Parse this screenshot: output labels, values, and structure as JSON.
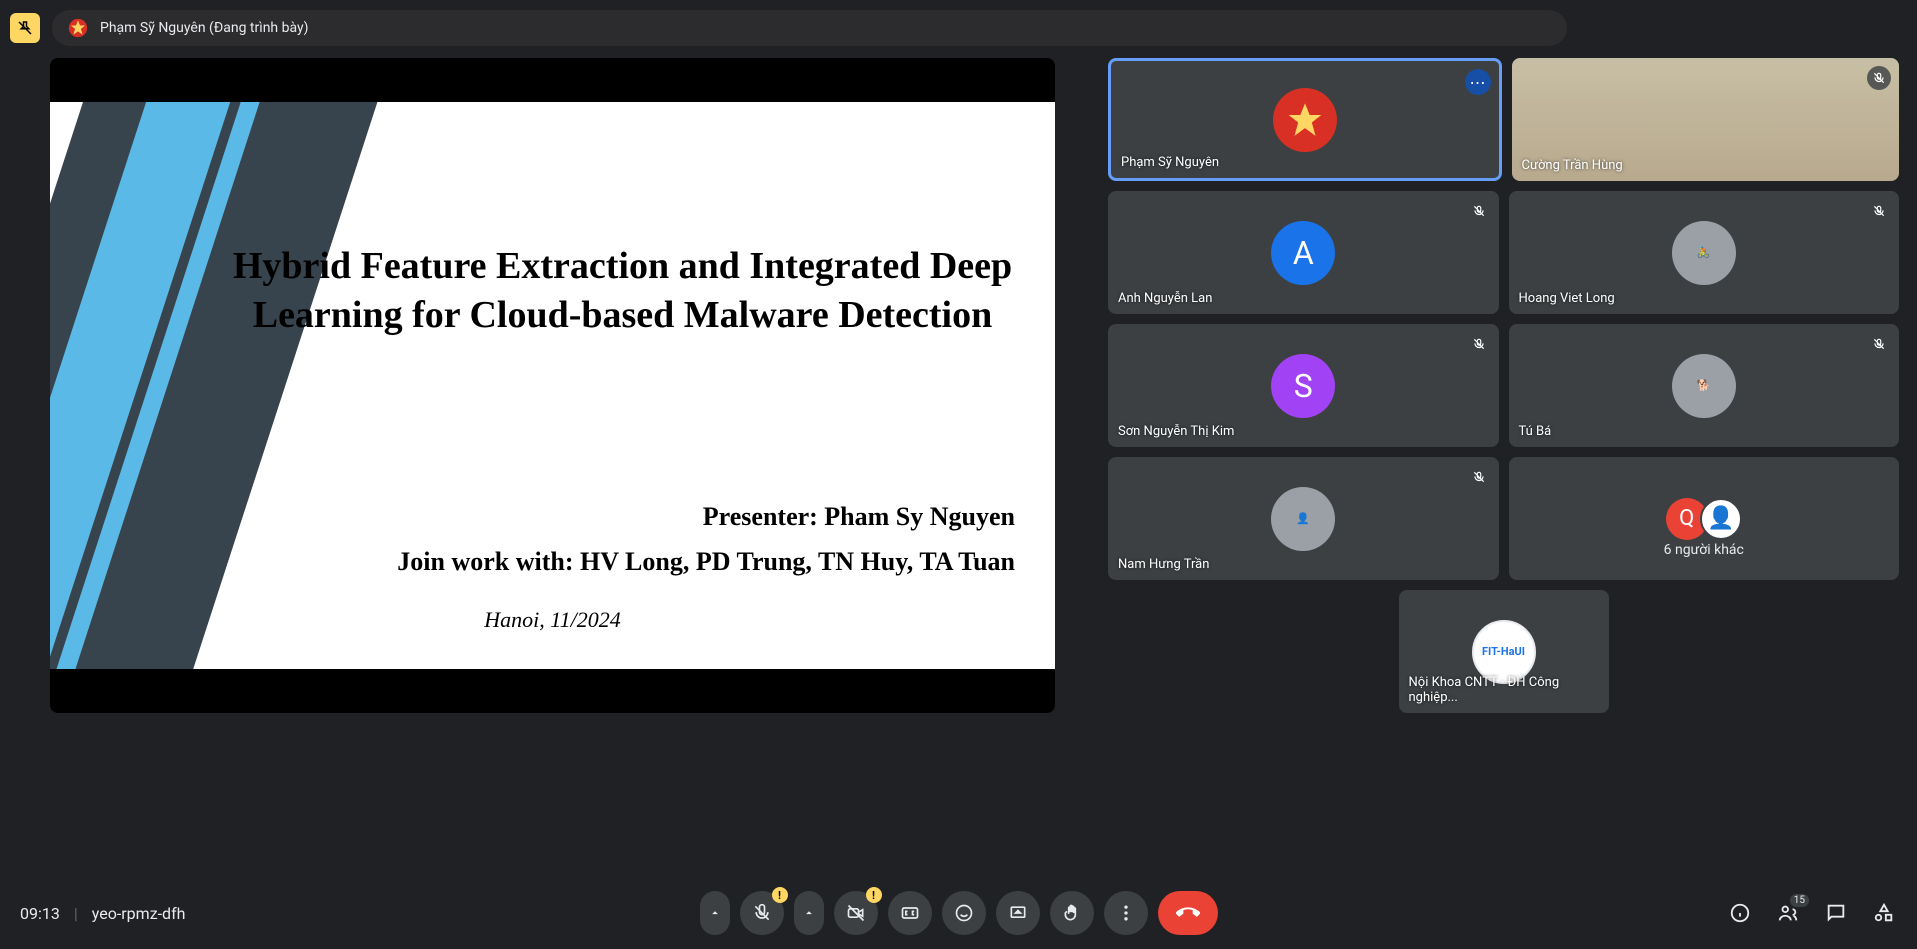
{
  "header": {
    "presenter_label": "Phạm Sỹ Nguyên (Đang trình bày)"
  },
  "slide": {
    "title": "Hybrid Feature Extraction and Integrated Deep Learning for Cloud-based Malware Detection",
    "presenter": "Presenter: Pham Sy Nguyen",
    "authors": "Join work with: HV Long, PD Trung, TN Huy, TA Tuan",
    "date_location": "Hanoi, 11/2024"
  },
  "participants": {
    "p1": {
      "name": "Phạm Sỹ Nguyên"
    },
    "p2": {
      "name": "Cường Trần Hùng"
    },
    "p3": {
      "name": "Anh Nguyễn Lan",
      "initial": "A"
    },
    "p4": {
      "name": "Hoang Viet Long"
    },
    "p5": {
      "name": "Sơn Nguyễn Thị Kim",
      "initial": "S"
    },
    "p6": {
      "name": "Tú Bá"
    },
    "p7": {
      "name": "Nam Hưng Trần"
    },
    "p8": {
      "others_label": "6 người khác",
      "initial": "Q"
    },
    "p9": {
      "name": "Nội Khoa CNTT - ĐH Công nghiệp..."
    }
  },
  "bottom": {
    "time": "09:13",
    "meeting_code": "yeo-rpmz-dfh",
    "warn": "!",
    "people_count": "15"
  }
}
